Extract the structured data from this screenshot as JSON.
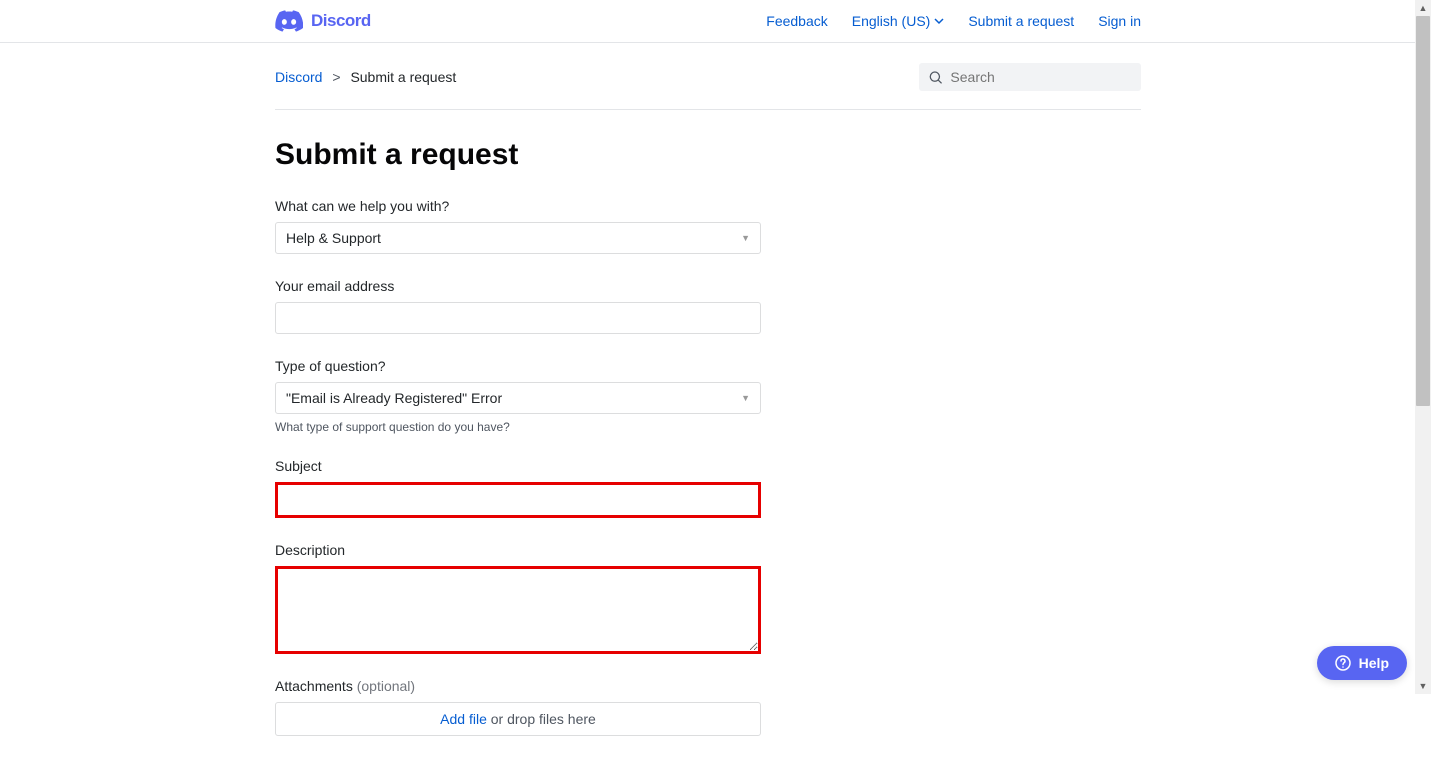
{
  "header": {
    "brand": "Discord",
    "nav": {
      "feedback": "Feedback",
      "language": "English (US)",
      "submit": "Submit a request",
      "signin": "Sign in"
    }
  },
  "breadcrumb": {
    "home": "Discord",
    "current": "Submit a request"
  },
  "search": {
    "placeholder": "Search"
  },
  "page": {
    "title": "Submit a request"
  },
  "form": {
    "help_with": {
      "label": "What can we help you with?",
      "value": "Help & Support"
    },
    "email": {
      "label": "Your email address",
      "value": ""
    },
    "question_type": {
      "label": "Type of question?",
      "value": "\"Email is Already Registered\" Error",
      "hint": "What type of support question do you have?"
    },
    "subject": {
      "label": "Subject",
      "value": ""
    },
    "description": {
      "label": "Description",
      "value": ""
    },
    "attachments": {
      "label": "Attachments",
      "optional": "(optional)",
      "add_file": "Add file",
      "drop_text": " or drop files here"
    }
  },
  "help_widget": {
    "label": "Help"
  }
}
